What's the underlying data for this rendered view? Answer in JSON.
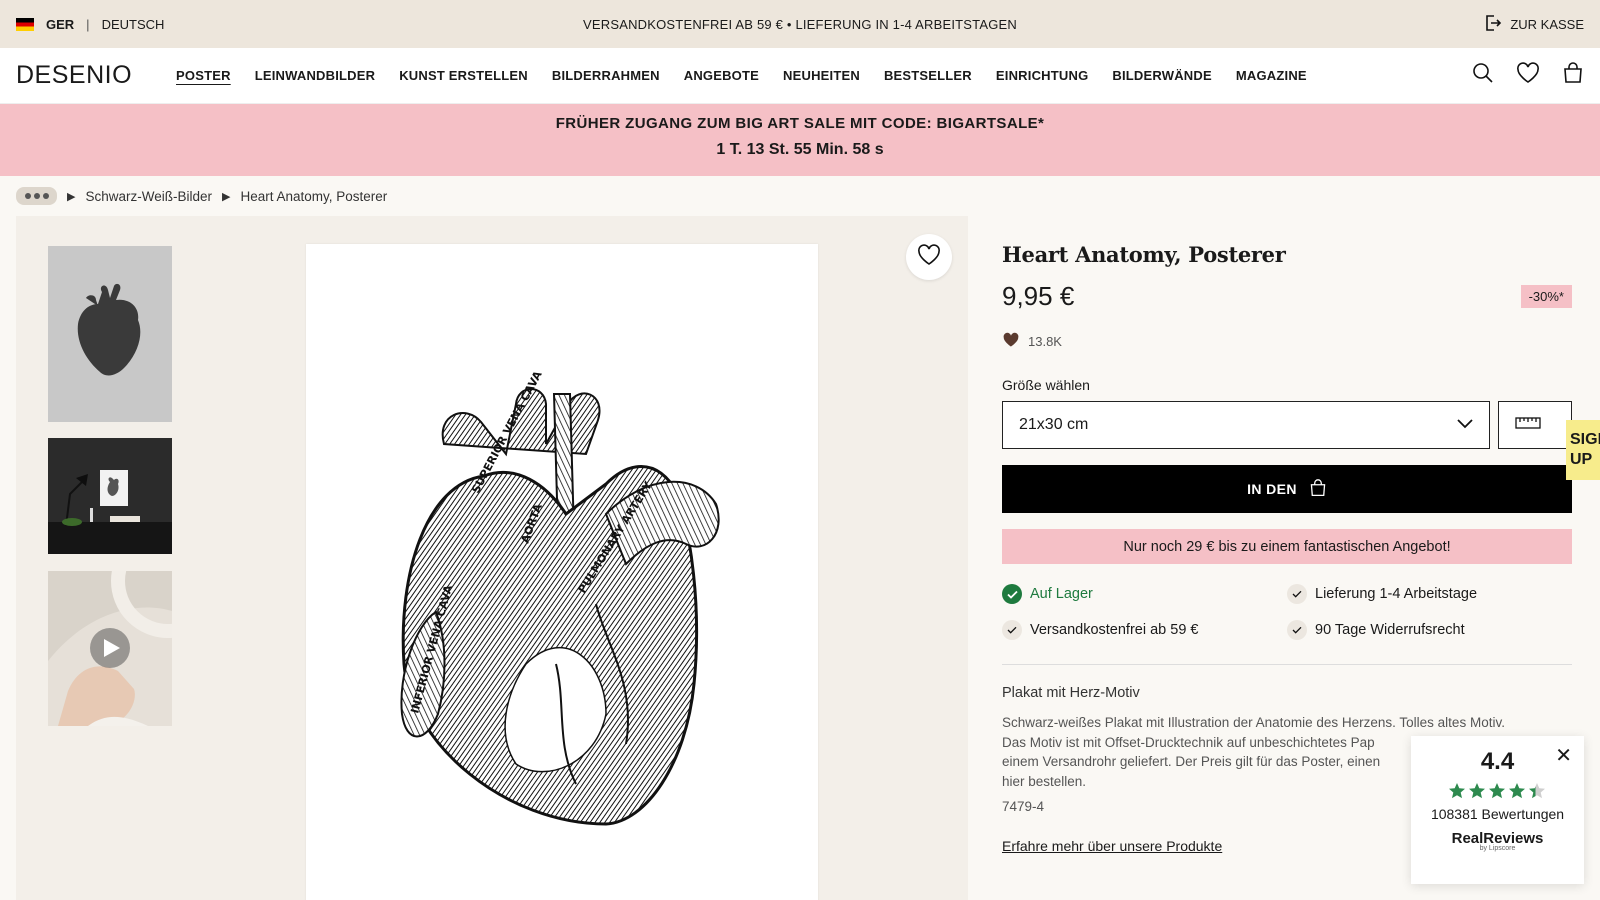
{
  "topbar": {
    "country_code": "GER",
    "language": "DEUTSCH",
    "promo": "VERSANDKOSTENFREI AB 59 € • LIEFERUNG IN 1-4 ARBEITSTAGEN",
    "checkout": "ZUR KASSE"
  },
  "brand": {
    "logo": "DESENIO"
  },
  "menu": [
    "POSTER",
    "LEINWANDBILDER",
    "KUNST ERSTELLEN",
    "BILDERRAHMEN",
    "ANGEBOTE",
    "NEUHEITEN",
    "BESTSELLER",
    "EINRICHTUNG",
    "BILDERWÄNDE",
    "MAGAZINE"
  ],
  "sale_banner": {
    "line1": "FRÜHER ZUGANG ZUM BIG ART SALE MIT CODE: BIGARTSALE*",
    "countdown": "1 T. 13 St. 55 Min. 58 s"
  },
  "breadcrumb": {
    "category": "Schwarz-Weiß-Bilder",
    "current": "Heart Anatomy, Posterer"
  },
  "product": {
    "title": "Heart Anatomy, Posterer",
    "price": "9,95 €",
    "discount_badge": "-30%*",
    "likes": "13.8K",
    "size_label": "Größe wählen",
    "size_selected": "21x30 cm",
    "add_to_cart": "IN DEN",
    "offer_text": "Nur noch 29 € bis zu einem fantastischen Angebot!",
    "usps": {
      "stock": "Auf Lager",
      "delivery": "Lieferung 1-4 Arbeitstage",
      "shipping": "Versandkostenfrei ab 59 €",
      "returns": "90 Tage Widerrufsrecht"
    },
    "desc_title": "Plakat mit Herz-Motiv",
    "desc_line1": "Schwarz-weißes Plakat mit Illustration der Anatomie des Herzens. Tolles altes Motiv.",
    "desc_line2": "Das Motiv ist mit Offset-Drucktechnik auf unbeschichtetes Pap",
    "desc_line3": "einem Versandrohr geliefert. Der Preis gilt für das Poster, einen",
    "desc_line4": "hier bestellen.",
    "sku": "7479-4",
    "learn_more": "Erfahre mehr über unsere Produkte"
  },
  "signup": {
    "line1": "SIGN",
    "line2": "UP"
  },
  "reviews": {
    "score": "4.4",
    "count": "108381 Bewertungen",
    "brand": "RealReviews",
    "brand_sub": "by Lipscore",
    "rating": 4.4
  },
  "colors": {
    "topbar": "#ede6dc",
    "promo_pink": "#f5c0c6",
    "in_stock": "#1e7a3e",
    "signup": "#f7ec8c"
  }
}
